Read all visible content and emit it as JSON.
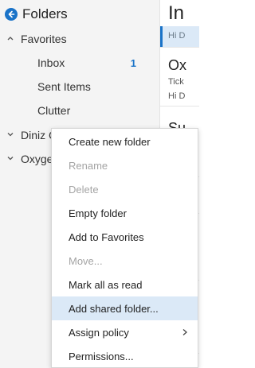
{
  "folder_pane": {
    "title": "Folders",
    "favorites": {
      "label": "Favorites",
      "items": [
        {
          "label": "Inbox",
          "count": "1"
        },
        {
          "label": "Sent Items"
        },
        {
          "label": "Clutter"
        }
      ]
    },
    "accounts": [
      {
        "label": "Diniz C"
      },
      {
        "label": "Oxyge"
      }
    ]
  },
  "reading_pane": {
    "title": "In",
    "selected_preview": "Hi D",
    "heading_1": "Ox",
    "line_1": "Tick",
    "line_2": "Hi D",
    "heading_2": "Su"
  },
  "context_menu": {
    "items": [
      {
        "label": "Create new folder",
        "enabled": true
      },
      {
        "label": "Rename",
        "enabled": false
      },
      {
        "label": "Delete",
        "enabled": false
      },
      {
        "label": "Empty folder",
        "enabled": true
      },
      {
        "label": "Add to Favorites",
        "enabled": true
      },
      {
        "label": "Move...",
        "enabled": false
      },
      {
        "label": "Mark all as read",
        "enabled": true
      },
      {
        "label": "Add shared folder...",
        "enabled": true,
        "highlighted": true
      },
      {
        "label": "Assign policy",
        "enabled": true,
        "submenu": true
      },
      {
        "label": "Permissions...",
        "enabled": true
      }
    ]
  },
  "colors": {
    "accent": "#1a73c8",
    "pane_background": "#f4f4f4",
    "highlight": "#dbe9f7",
    "disabled_text": "#a4a4a4"
  }
}
